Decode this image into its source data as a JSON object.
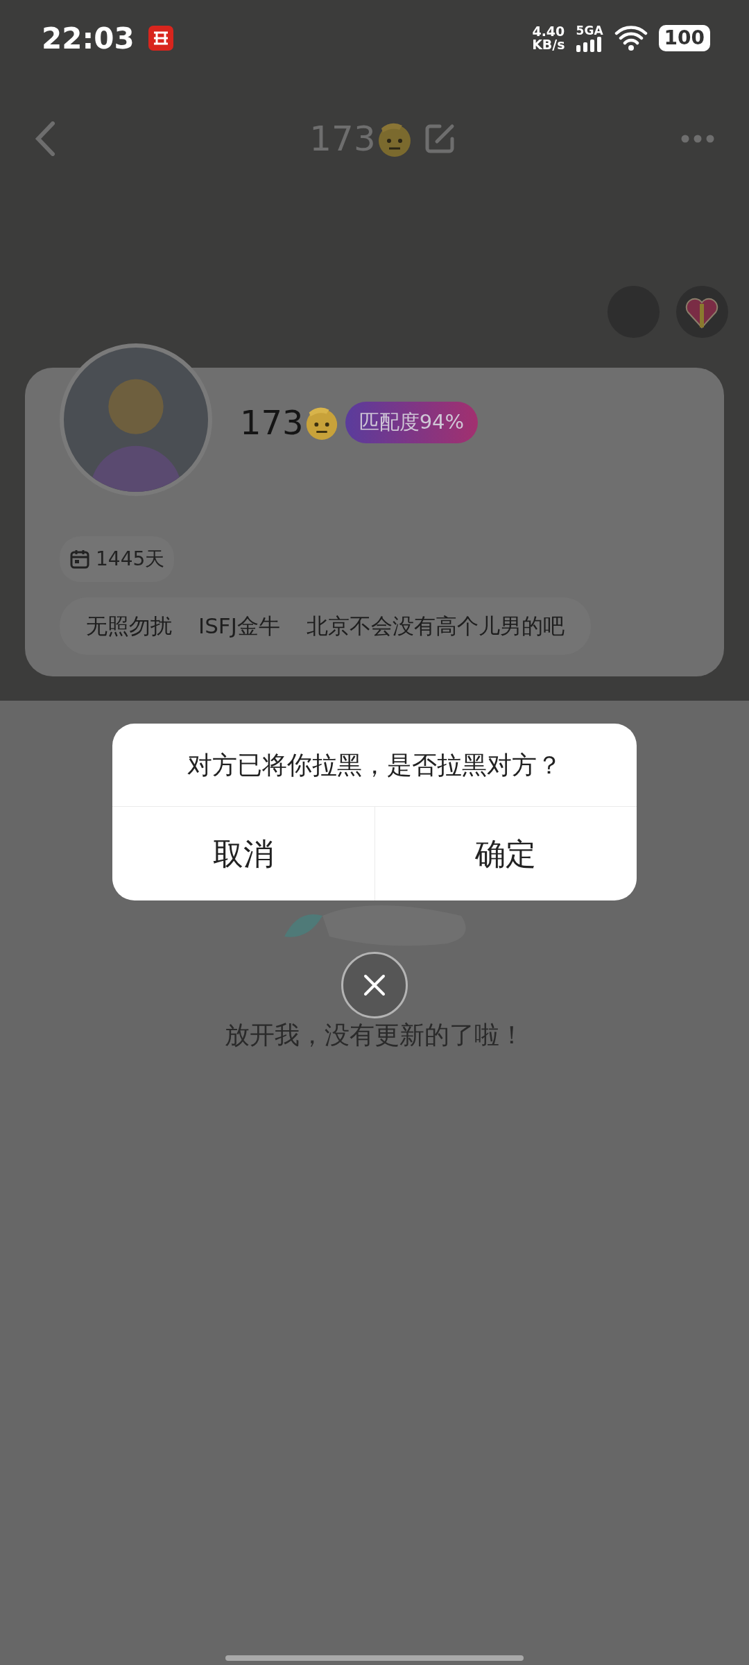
{
  "status_bar": {
    "time": "22:03",
    "net_speed": "4.40",
    "net_unit": "KB/s",
    "network": "5GA",
    "battery": "100"
  },
  "header": {
    "title": "173"
  },
  "profile": {
    "name": "173",
    "match": "匹配度94%",
    "days": "1445天",
    "tags": [
      "无照勿扰",
      "ISFJ金牛",
      "北京不会没有高个儿男的吧"
    ]
  },
  "empty_state": {
    "message": "放开我，没有更新的了啦！"
  },
  "dialog": {
    "message": "对方已将你拉黑，是否拉黑对方？",
    "buttons": [
      "取消",
      "确定"
    ]
  }
}
